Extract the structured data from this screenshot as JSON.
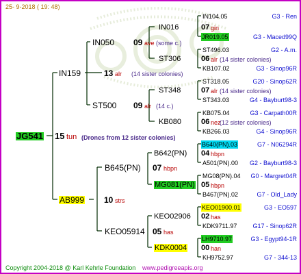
{
  "header": {
    "date": "25-  9-2018 ( 19: 48)"
  },
  "footer": {
    "copyright": "Copyright 2004-2018 @ Karl Kehrle Foundation",
    "website": "www.pedigreeapis.org"
  },
  "colors": {
    "frame": "#c400c4",
    "tree_line": "#002a00",
    "green": "#22cc22",
    "yellow": "#ffff00",
    "cyan": "#00d8f0",
    "red": "#b80000",
    "blue": "#1010d0",
    "purple": "#4a2a8a"
  },
  "root": {
    "id": "JG541",
    "gen": "15",
    "breed": "tun",
    "note": "(Drones from 12 sister colonies)"
  },
  "sire": {
    "id": "IN159",
    "gen": "13",
    "breed": "alr",
    "note": "(14 sister colonies)"
  },
  "dam": {
    "id": "AB999",
    "gen": "10",
    "breed": "strs"
  },
  "gen3": [
    {
      "id": "IN050",
      "gen": "09",
      "breed": "ave",
      "note": "(some c.)"
    },
    {
      "id": "ST500",
      "gen": "09",
      "breed": "alr",
      "note": "(14 c.)"
    },
    {
      "id": "B645(PN)",
      "gen": "07",
      "breed": "hbpn"
    },
    {
      "id": "KEO05914",
      "gen": "05",
      "breed": "has"
    }
  ],
  "gen4": [
    {
      "id": "IN016",
      "gen": "07",
      "breed": "gin"
    },
    {
      "id": "ST306",
      "gen": "06",
      "breed": "alr",
      "note": "(14 sister colonies)"
    },
    {
      "id": "ST348",
      "gen": "07",
      "breed": "alr",
      "note": "(14 sister colonies)"
    },
    {
      "id": "KB080",
      "gen": "06",
      "breed": "nez",
      "note": "(12 sister colonies)"
    },
    {
      "id": "B642(PN)",
      "gen": "04",
      "breed": "hbpn"
    },
    {
      "id": "MG081(PN)",
      "gen": "05",
      "breed": "hbpn"
    },
    {
      "id": "KEO02906",
      "gen": "02",
      "breed": "has"
    },
    {
      "id": "KDK0004",
      "gen": "00",
      "breed": "han"
    }
  ],
  "gen5": [
    {
      "id": "IN104.05",
      "code": "G3 - Ren"
    },
    {
      "id": "JR019.05",
      "code": "G3 - Maced99Q"
    },
    {
      "id": "ST496.03",
      "code": "G2 - A.m."
    },
    {
      "id": "KB107.02",
      "code": "G3 - Sinop96R"
    },
    {
      "id": "ST318.05",
      "code": "G20 - Sinop62R"
    },
    {
      "id": "ST343.03",
      "code": "G4 - Bayburt98-3"
    },
    {
      "id": "KB075.04",
      "code": "G3 - Carpath00R"
    },
    {
      "id": "KB266.03",
      "code": "G4 - Sinop96R"
    },
    {
      "id": "B640(PN).03",
      "code": "G7 - N06294R"
    },
    {
      "id": "A501(PN).00",
      "code": "G2 - Bayburt98-3"
    },
    {
      "id": "MG08(PN).04",
      "code": "G0 - Margret04R"
    },
    {
      "id": "B467(PN).02",
      "code": "G7 - Old_Lady"
    },
    {
      "id": "KEO01900.01",
      "code": "G3 - EO597"
    },
    {
      "id": "KDK9711.97",
      "code": "G17 - Sinop62R"
    },
    {
      "id": "LH9710.97",
      "code": "G3 - Egypt94-1R"
    },
    {
      "id": "KH9752.97",
      "code": "G7 - 344-13"
    }
  ]
}
